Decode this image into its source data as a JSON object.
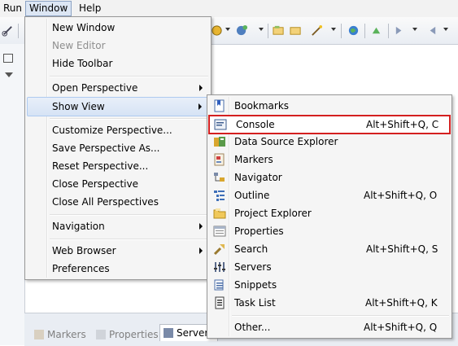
{
  "menubar": {
    "items": [
      "Run",
      "Window",
      "Help"
    ],
    "active": "Window"
  },
  "window_menu": {
    "items": [
      {
        "label": "New Window",
        "enabled": true
      },
      {
        "label": "New Editor",
        "enabled": false
      },
      {
        "label": "Hide Toolbar",
        "enabled": true
      },
      {
        "label": "Open Perspective",
        "submenu": true
      },
      {
        "label": "Show View",
        "submenu": true,
        "hover": true
      },
      {
        "label": "Customize Perspective...",
        "enabled": true
      },
      {
        "label": "Save Perspective As...",
        "enabled": true
      },
      {
        "label": "Reset Perspective...",
        "enabled": true
      },
      {
        "label": "Close Perspective",
        "enabled": true
      },
      {
        "label": "Close All Perspectives",
        "enabled": true
      },
      {
        "label": "Navigation",
        "submenu": true
      },
      {
        "label": "Web Browser",
        "submenu": true
      },
      {
        "label": "Preferences",
        "enabled": true
      }
    ]
  },
  "show_view_menu": {
    "items": [
      {
        "label": "Bookmarks",
        "shortcut": "",
        "icon": "bookmarks-icon"
      },
      {
        "label": "Console",
        "shortcut": "Alt+Shift+Q, C",
        "icon": "console-icon",
        "highlighted": true
      },
      {
        "label": "Data Source Explorer",
        "shortcut": "",
        "icon": "data-source-explorer-icon"
      },
      {
        "label": "Markers",
        "shortcut": "",
        "icon": "markers-icon"
      },
      {
        "label": "Navigator",
        "shortcut": "",
        "icon": "navigator-icon"
      },
      {
        "label": "Outline",
        "shortcut": "Alt+Shift+Q, O",
        "icon": "outline-icon"
      },
      {
        "label": "Project Explorer",
        "shortcut": "",
        "icon": "project-explorer-icon"
      },
      {
        "label": "Properties",
        "shortcut": "",
        "icon": "properties-icon"
      },
      {
        "label": "Search",
        "shortcut": "Alt+Shift+Q, S",
        "icon": "search-icon"
      },
      {
        "label": "Servers",
        "shortcut": "",
        "icon": "servers-icon"
      },
      {
        "label": "Snippets",
        "shortcut": "",
        "icon": "snippets-icon"
      },
      {
        "label": "Task List",
        "shortcut": "Alt+Shift+Q, K",
        "icon": "task-list-icon"
      },
      {
        "label": "Other...",
        "shortcut": "Alt+Shift+Q, Q",
        "icon": ""
      }
    ]
  },
  "bottom_tabs": [
    {
      "label": "Markers",
      "active": false
    },
    {
      "label": "Properties",
      "active": false
    },
    {
      "label": "Servers",
      "active": true
    }
  ],
  "colors": {
    "highlight_border": "#d42020",
    "hover_fill": "#d6e3f5",
    "menu_bg": "#f5f5f5"
  }
}
